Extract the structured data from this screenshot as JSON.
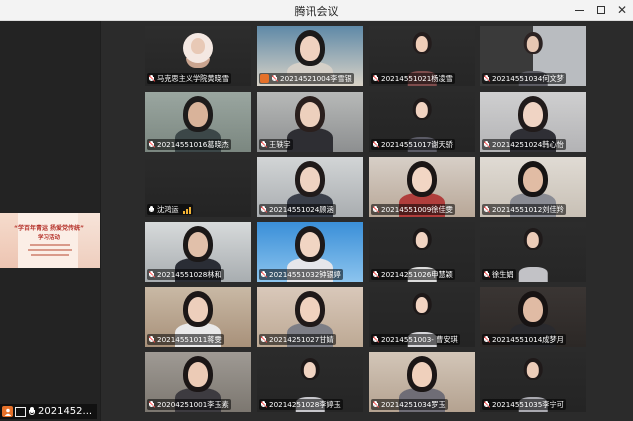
{
  "window": {
    "title": "腾讯会议",
    "controls": [
      "minimize",
      "maximize",
      "close"
    ]
  },
  "shared_screen": {
    "title": "“学百年青运 扬爱党传统”",
    "subtitle": "学习活动"
  },
  "self_view": {
    "name": "2021452..."
  },
  "participants": [
    {
      "name": "马克思主义学院黄晓雪",
      "mic": "muted"
    },
    {
      "name": "20214521004李雪银",
      "mic": "muted",
      "host": true
    },
    {
      "name": "20214551021杨凌雪",
      "mic": "muted"
    },
    {
      "name": "20214551034何文梦",
      "mic": "muted"
    },
    {
      "name": "20214551016葛晓杰",
      "mic": "muted"
    },
    {
      "name": "王轶宇",
      "mic": "muted"
    },
    {
      "name": "20214551017谢天骄",
      "mic": "muted"
    },
    {
      "name": "20214251024韩心怡",
      "mic": "muted"
    },
    {
      "name": "沈鸿运",
      "mic": "active"
    },
    {
      "name": "20214551024顾涵",
      "mic": "muted"
    },
    {
      "name": "20214551009徐佳雯",
      "mic": "muted"
    },
    {
      "name": "20214551012刘佳羚",
      "mic": "muted"
    },
    {
      "name": "20214551028林和",
      "mic": "muted"
    },
    {
      "name": "20214551032钟银婷",
      "mic": "muted"
    },
    {
      "name": "20214251026申慧颖",
      "mic": "muted"
    },
    {
      "name": "徐生娟",
      "mic": "muted"
    },
    {
      "name": "20214551011蒋雯",
      "mic": "muted"
    },
    {
      "name": "20214251027甘婧",
      "mic": "muted"
    },
    {
      "name": "20214551003- 曹安琪",
      "mic": "muted"
    },
    {
      "name": "20214551014成梦月",
      "mic": "muted"
    },
    {
      "name": "20204251001李玉素",
      "mic": "muted"
    },
    {
      "name": "20214251028李婷玉",
      "mic": "muted"
    },
    {
      "name": "20214251034罗玉",
      "mic": "muted"
    },
    {
      "name": "20214551035李宁可",
      "mic": "muted"
    }
  ],
  "colors": {
    "host_badge": "#e5712a",
    "signal": "#f2b335",
    "muted_slash": "#ff4a4a"
  }
}
